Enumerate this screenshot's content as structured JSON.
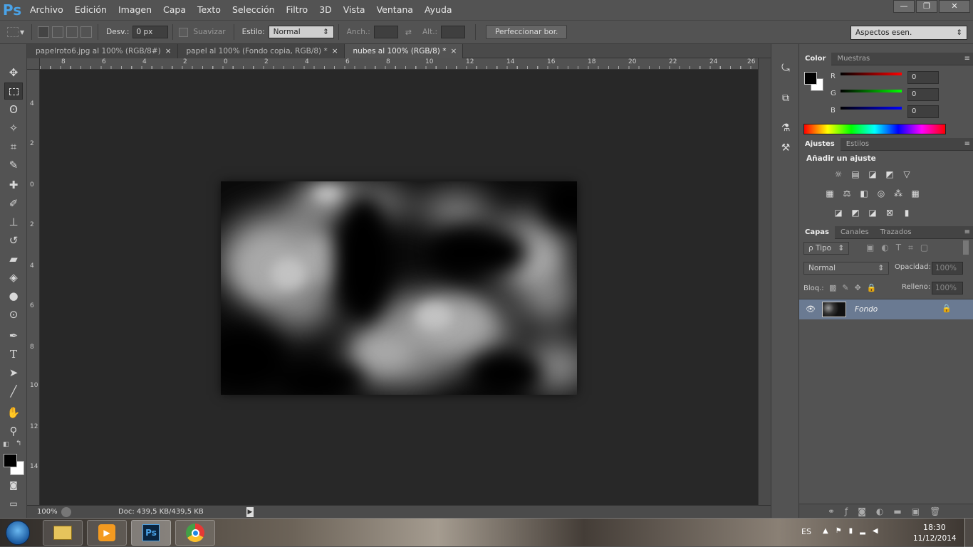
{
  "app": {
    "logo": "Ps"
  },
  "menu": [
    "Archivo",
    "Edición",
    "Imagen",
    "Capa",
    "Texto",
    "Selección",
    "Filtro",
    "3D",
    "Vista",
    "Ventana",
    "Ayuda"
  ],
  "window_controls": {
    "minimize": "—",
    "restore": "❐",
    "close": "✕"
  },
  "options": {
    "desv_label": "Desv.:",
    "desv_value": "0 px",
    "suavizar_label": "Suavizar",
    "estilo_label": "Estilo:",
    "estilo_value": "Normal",
    "anch_label": "Anch.:",
    "alt_label": "Alt.:",
    "refine_button": "Perfeccionar bor.",
    "workspace": "Aspectos esen."
  },
  "tabs": [
    {
      "label": "papelroto6.jpg al 100% (RGB/8#)",
      "close": "×"
    },
    {
      "label": "papel al 100% (Fondo copia, RGB/8) *",
      "close": "×"
    },
    {
      "label": "nubes al 100% (RGB/8) *",
      "close": "×"
    }
  ],
  "ruler_top": [
    "8",
    "6",
    "4",
    "2",
    "0",
    "2",
    "4",
    "6",
    "8",
    "10",
    "12",
    "14",
    "16",
    "18",
    "20",
    "22",
    "24",
    "26"
  ],
  "ruler_left": [
    "4",
    "2",
    "0",
    "2",
    "4",
    "6",
    "8",
    "10",
    "12",
    "14"
  ],
  "status": {
    "zoom": "100%",
    "doc": "Doc: 439,5 KB/439,5 KB"
  },
  "color_panel": {
    "tabs": [
      "Color",
      "Muestras"
    ],
    "channels": [
      {
        "label": "R",
        "value": "0",
        "color": "#ff0000"
      },
      {
        "label": "G",
        "value": "0",
        "color": "#00ff00"
      },
      {
        "label": "B",
        "value": "0",
        "color": "#0000ff"
      }
    ]
  },
  "adjust_panel": {
    "tabs": [
      "Ajustes",
      "Estilos"
    ],
    "title": "Añadir un ajuste"
  },
  "layers_panel": {
    "tabs": [
      "Capas",
      "Canales",
      "Trazados"
    ],
    "filter": "ρ Tipo",
    "blend": "Normal",
    "opacity_label": "Opacidad:",
    "opacity_value": "100%",
    "lock_label": "Bloq.:",
    "fill_label": "Relleno:",
    "fill_value": "100%",
    "layer_name": "Fondo"
  },
  "taskbar": {
    "lang": "ES",
    "time": "18:30",
    "date": "11/12/2014"
  }
}
